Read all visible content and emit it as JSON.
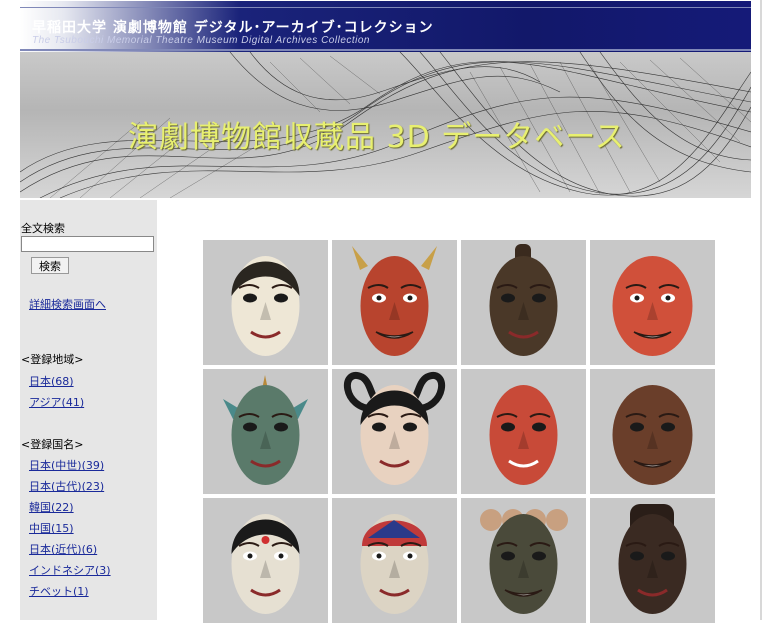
{
  "header": {
    "title": "早稲田大学 演劇博物館 デジタル･アーカイブ･コレクション",
    "subtitle": "The Tsubouchi Memorial Theatre Museum Digital Archives Collection"
  },
  "banner": {
    "title": "演劇博物館収蔵品 3D データベース"
  },
  "sidebar": {
    "search_heading": "全文検索",
    "search_value": "",
    "search_button": "検索",
    "advanced_link": "詳細検索画面へ",
    "region_heading": "<登録地域>",
    "regions": [
      {
        "label": "日本(68)"
      },
      {
        "label": "アジア(41)"
      }
    ],
    "country_heading": "<登録国名>",
    "countries": [
      {
        "label": "日本(中世)(39)"
      },
      {
        "label": "日本(古代)(23)"
      },
      {
        "label": "韓国(22)"
      },
      {
        "label": "中国(15)"
      },
      {
        "label": "日本(近代)(6)"
      },
      {
        "label": "インドネシア(3)"
      },
      {
        "label": "チベット(1)"
      }
    ]
  },
  "grid": {
    "tiles": [
      {
        "icon": "noh-woman-mask-icon",
        "face": "#eee7d6",
        "hair": "#2a2620",
        "kind": "noh"
      },
      {
        "icon": "hannya-demon-mask-icon",
        "face": "#b8442e",
        "hair": "#3a2018",
        "kind": "hannya"
      },
      {
        "icon": "dark-wooden-mask-icon",
        "face": "#4a3828",
        "hair": "#2a2018",
        "kind": "dark"
      },
      {
        "icon": "red-tengu-mask-icon",
        "face": "#d0503a",
        "hair": "#c04030",
        "kind": "red"
      },
      {
        "icon": "ornate-green-mask-icon",
        "face": "#5a7a6a",
        "hair": "#8a6a3a",
        "kind": "ornate"
      },
      {
        "icon": "black-hair-loop-mask-icon",
        "face": "#e8d2c0",
        "hair": "#1a1a1a",
        "kind": "loops"
      },
      {
        "icon": "red-smiling-mask-icon",
        "face": "#c84a38",
        "hair": "#b84030",
        "kind": "smile"
      },
      {
        "icon": "brown-wooden-mask-icon",
        "face": "#6a3e2a",
        "hair": "#4a2a1a",
        "kind": "brown"
      },
      {
        "icon": "white-dotted-mask-icon",
        "face": "#e6e0d2",
        "hair": "#1a1a1a",
        "kind": "white1"
      },
      {
        "icon": "white-red-cap-mask-icon",
        "face": "#dcd4c4",
        "hair": "#c03a3a",
        "kind": "white2"
      },
      {
        "icon": "skull-crown-mask-icon",
        "face": "#4a4a3a",
        "hair": "#b89070",
        "kind": "skull"
      },
      {
        "icon": "dark-helmet-mask-icon",
        "face": "#3a2a22",
        "hair": "#2a1e18",
        "kind": "helmet"
      }
    ]
  }
}
